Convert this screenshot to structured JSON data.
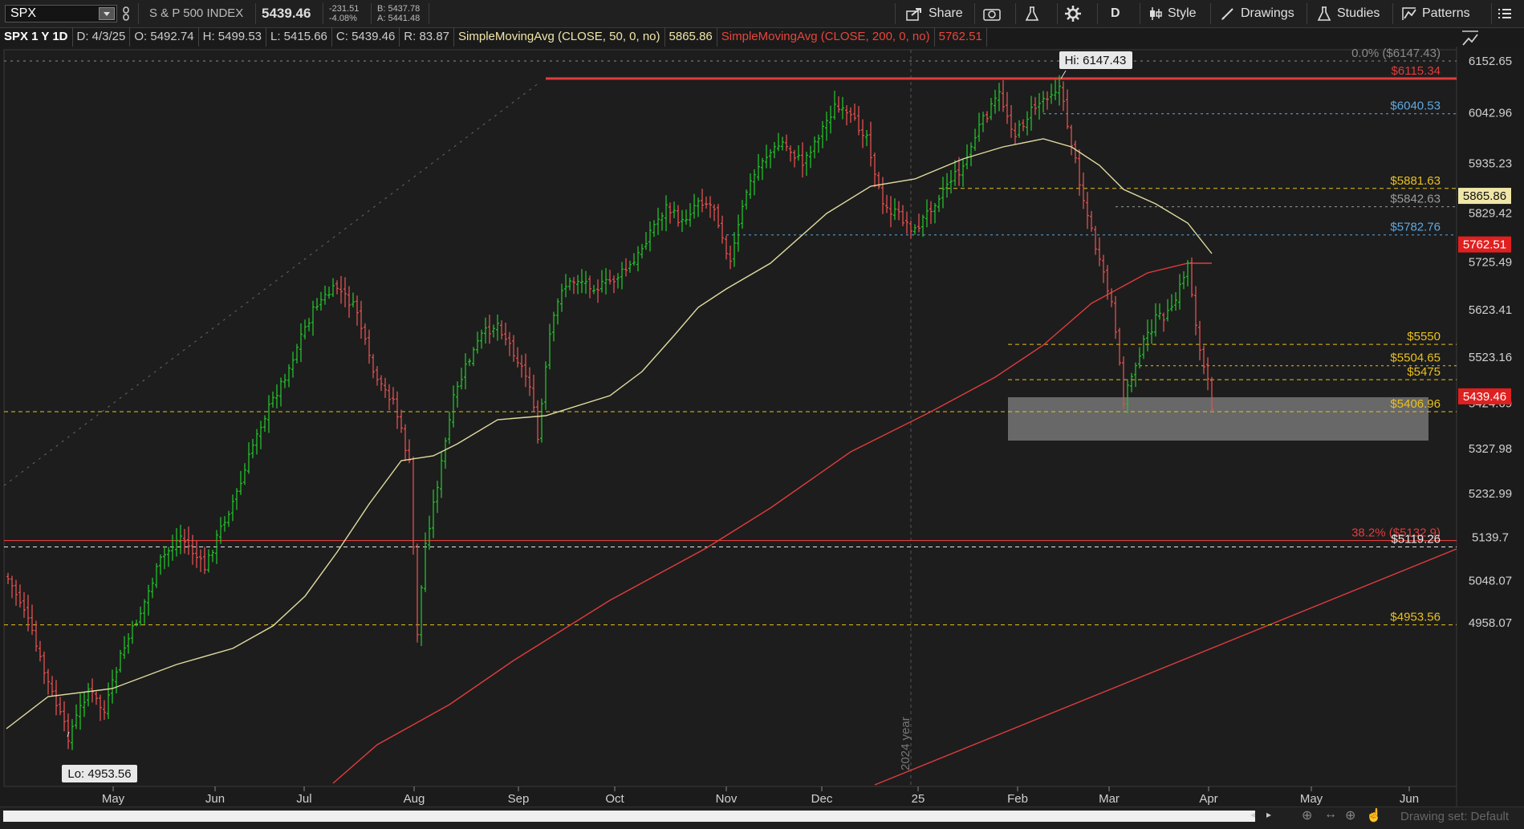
{
  "toolbar": {
    "symbol": "SPX",
    "name": "S & P 500 INDEX",
    "last": "5439.46",
    "change": "-231.51",
    "change_pct": "-4.08%",
    "bid": "B: 5437.78",
    "ask": "A: 5441.48",
    "share": "Share",
    "aggregation": "D",
    "style": "Style",
    "drawings": "Drawings",
    "studies": "Studies",
    "patterns": "Patterns"
  },
  "infobar": {
    "title": "SPX 1 Y 1D",
    "date": "D: 4/3/25",
    "open": "O: 5492.74",
    "high": "H: 5499.53",
    "low": "L: 5415.66",
    "close": "C: 5439.46",
    "range": "R: 83.87",
    "sma50_label": "SimpleMovingAvg (CLOSE, 50, 0, no)",
    "sma50_value": "5865.86",
    "sma200_label": "SimpleMovingAvg (CLOSE, 200, 0, no)",
    "sma200_value": "5762.51"
  },
  "footer": {
    "drawing_set": "Drawing set: Default"
  },
  "colors": {
    "up": "#22c02a",
    "down": "#e05050",
    "sma50": "#e0dca0",
    "sma200": "#e03c3c",
    "gold": "#e8c020",
    "blue": "#5fa8e0"
  },
  "chart_data": {
    "type": "ohlc",
    "yticks": [
      6152.65,
      6042.96,
      5935.23,
      5829.42,
      5725.49,
      5623.41,
      5523.16,
      5424.69,
      5327.98,
      5232.99,
      5139.7,
      5048.07,
      4958.07
    ],
    "ytick_labels": [
      "6152.65",
      "6042.96",
      "5935.23",
      "5829.42",
      "5725.49",
      "5623.41",
      "5523.16",
      "5424.69",
      "5327.98",
      "5232.99",
      "5139.7",
      "5048.07",
      "4958.07"
    ],
    "ylim": [
      4927,
      6176
    ],
    "months": [
      "May",
      "Jun",
      "Jul",
      "Aug",
      "Sep",
      "Oct",
      "Nov",
      "Dec",
      "25",
      "Feb",
      "Mar",
      "Apr",
      "May",
      "Jun"
    ],
    "year_marker": "2024 year",
    "hi_label": "Hi: 6147.43",
    "lo_label": "Lo: 4953.56",
    "price_tags": [
      {
        "value": 5865.86,
        "label": "5865.86",
        "bg": "#f0e6a8",
        "fg": "#111"
      },
      {
        "value": 5762.51,
        "label": "5762.51",
        "bg": "#e02020",
        "fg": "#fff"
      },
      {
        "value": 5439.46,
        "label": "5439.46",
        "bg": "#e02020",
        "fg": "#fff"
      }
    ],
    "levels": [
      {
        "value": 6152.65,
        "label": "0.0%  ($6147.43)",
        "color": "#8a8a8a"
      },
      {
        "value": 6115.34,
        "label": "$6115.34",
        "color": "#e03c3c"
      },
      {
        "value": 6040.53,
        "label": "$6040.53",
        "color": "#5fa8e0"
      },
      {
        "value": 5881.63,
        "label": "$5881.63",
        "color": "#e8c020"
      },
      {
        "value": 5842.63,
        "label": "$5842.63",
        "color": "#9a9a9a"
      },
      {
        "value": 5782.76,
        "label": "$5782.76",
        "color": "#5fa8e0"
      },
      {
        "value": 5550,
        "label": "$5550",
        "color": "#e8c020"
      },
      {
        "value": 5504.65,
        "label": "$5504.65",
        "color": "#e8c020"
      },
      {
        "value": 5475,
        "label": "$5475",
        "color": "#e8c020"
      },
      {
        "value": 5406.96,
        "label": "$5406.96",
        "color": "#e8c020"
      },
      {
        "value": 5132.9,
        "label": "38.2%  ($5132.9)",
        "color": "#e03c3c"
      },
      {
        "value": 5119.26,
        "label": "$5119.26",
        "color": "#e8e8e8"
      },
      {
        "value": 4953.56,
        "label": "$4953.56",
        "color": "#e8c020"
      }
    ]
  }
}
